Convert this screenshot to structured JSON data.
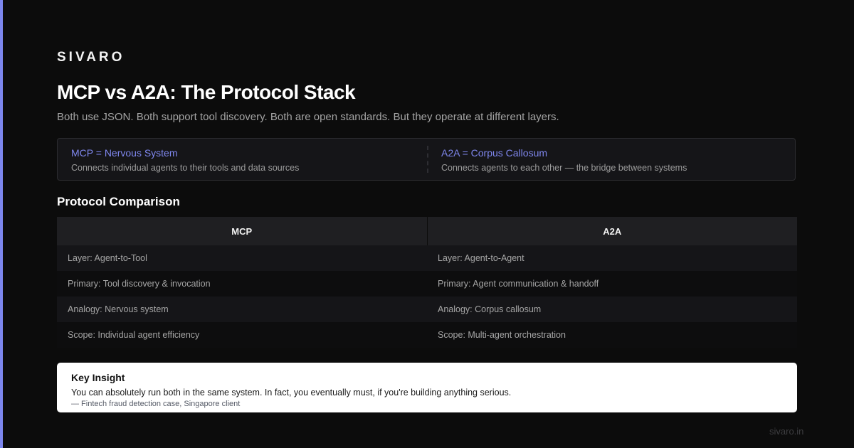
{
  "brand": "SIVARO",
  "title": "MCP vs A2A: The Protocol Stack",
  "subtitle": "Both use JSON. Both support tool discovery. Both are open standards. But they operate at different layers.",
  "analogies": [
    {
      "heading": "MCP = Nervous System",
      "description": "Connects individual agents to their tools and data sources"
    },
    {
      "heading": "A2A = Corpus Callosum",
      "description": "Connects agents to each other — the bridge between systems"
    }
  ],
  "comparison": {
    "section_title": "Protocol Comparison",
    "headers": [
      "MCP",
      "A2A"
    ],
    "rows": [
      [
        "Layer: Agent-to-Tool",
        "Layer: Agent-to-Agent"
      ],
      [
        "Primary: Tool discovery & invocation",
        "Primary: Agent communication & handoff"
      ],
      [
        "Analogy: Nervous system",
        "Analogy: Corpus callosum"
      ],
      [
        "Scope: Individual agent efficiency",
        "Scope: Multi-agent orchestration"
      ]
    ]
  },
  "insight": {
    "title": "Key Insight",
    "text": "You can absolutely run both in the same system. In fact, you eventually must, if you're building anything serious.",
    "source": "— Fintech fraud detection case, Singapore client"
  },
  "footer": "sivaro.in",
  "colors": {
    "accent": "#7c86ee",
    "background": "#0c0c0c",
    "insight_background": "#ffffff"
  }
}
